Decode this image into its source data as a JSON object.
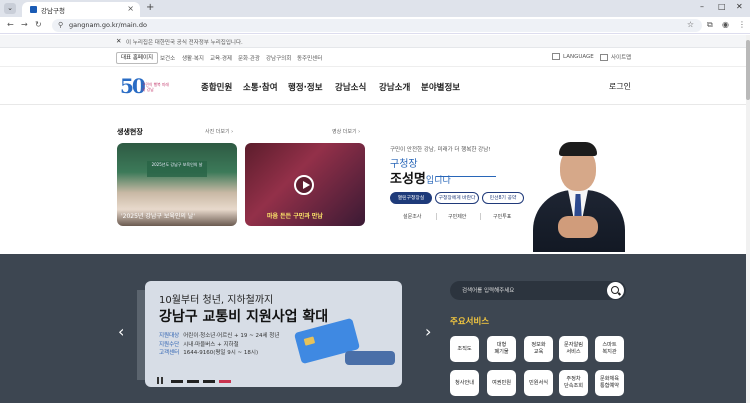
{
  "browser": {
    "tab_title": "강남구청",
    "url": "gangnam.go.kr/main.do"
  },
  "gov_banner": "이 누리집은 대한민국 공식 전자정부 누리집입니다.",
  "util": {
    "main_site": "대표 홈페이지",
    "links": [
      "보건소",
      "생활·복지",
      "교육·경제",
      "문화·관광",
      "강남구의회",
      "동주민센터"
    ],
    "language": "LANGUAGE",
    "sitemap": "사이트맵"
  },
  "logo": {
    "number": "50",
    "tagline": "구민이 행복 미래의 강남"
  },
  "gnb": {
    "menu": [
      "종합민원",
      "소통·참여",
      "행정·정보",
      "강남소식",
      "강남소개",
      "분야별정보"
    ],
    "login": "로그인"
  },
  "news": {
    "title": "생생현장",
    "photo_more": "사진 더보기",
    "video_more": "영상 더보기",
    "photo_caption": "'2025년 강남구 보육인의 날'",
    "photo_banner": "2025년도 강남구 보육인의 날",
    "video_overlay": "마음 든든 구민과 만남"
  },
  "mayor": {
    "tagline": "구민이 안전한 강남, 미래가 더 행복한 강남!",
    "title": "구청장",
    "name": "조성명",
    "name_suffix": "입니다",
    "buttons": [
      "열린구청장실",
      "구청장에게 바란다",
      "민선8기 공약"
    ],
    "links": [
      "설문조사",
      "구민제안",
      "구민투표"
    ]
  },
  "slider": {
    "line1": "10월부터 청년, 지하철까지",
    "line2": "강남구 교통비 지원사업 확대",
    "info": [
      {
        "label": "지원대상",
        "value": "어린이·청소년·어르신 + 19 ~ 24세 청년"
      },
      {
        "label": "지원수단",
        "value": "시내·마을버스 + 지하철"
      },
      {
        "label": "고객센터",
        "value": "1644-9160(평일 9시 ~ 18시)"
      }
    ]
  },
  "search": {
    "placeholder": "검색어를 입력해주세요"
  },
  "services": {
    "title": "주요서비스",
    "items": [
      "조직도",
      "대형\n폐기물",
      "정보화\n교육",
      "문자알림\n서비스",
      "스마트\n복지관",
      "청사안내",
      "여권민원",
      "민원서식",
      "주정차\n단속조회",
      "문화체육\n통합예약"
    ]
  }
}
